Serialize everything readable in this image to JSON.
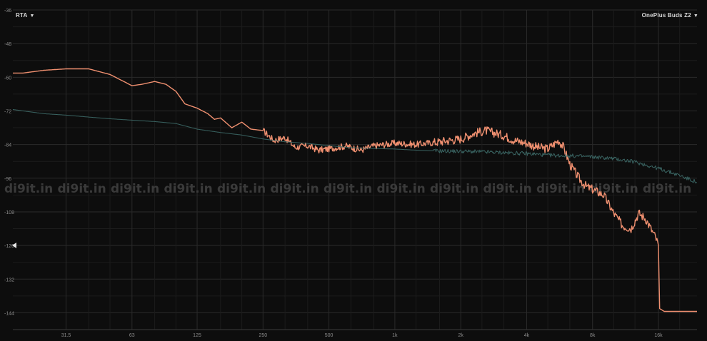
{
  "header": {
    "mode_label": "RTA",
    "device_label": "OnePlus Buds Z2"
  },
  "watermark": {
    "text": "di9it.in",
    "count": 13
  },
  "icons": {
    "mode_caret": "▼",
    "device_caret": "▼",
    "level_marker": "triangle-left"
  },
  "colors": {
    "background": "#0d0d0d",
    "grid": "#2a2a2a",
    "measured": "#f09070",
    "reference": "#3e6d6a",
    "tick_text": "#8c8c8c",
    "watermark": "#3a3a3a"
  },
  "chart_data": {
    "type": "line",
    "title": "",
    "xlabel": "",
    "ylabel": "",
    "xscale": "log",
    "xlim": [
      18,
      24000
    ],
    "ylim": [
      -150,
      -36
    ],
    "grid": true,
    "x_ticks": [
      {
        "value": 31.5,
        "label": "31.5"
      },
      {
        "value": 63,
        "label": "63"
      },
      {
        "value": 125,
        "label": "125"
      },
      {
        "value": 250,
        "label": "250"
      },
      {
        "value": 500,
        "label": "500"
      },
      {
        "value": 1000,
        "label": "1k"
      },
      {
        "value": 2000,
        "label": "2k"
      },
      {
        "value": 4000,
        "label": "4k"
      },
      {
        "value": 8000,
        "label": "8k"
      },
      {
        "value": 16000,
        "label": "16k"
      }
    ],
    "x_minor_ticks": [
      40,
      50,
      80,
      100,
      160,
      200,
      315,
      400,
      630,
      800,
      1250,
      1600,
      2500,
      3150,
      5000,
      6300,
      10000,
      12500,
      20000
    ],
    "y_ticks": [
      -36,
      -48,
      -60,
      -72,
      -84,
      -96,
      -108,
      -120,
      -132,
      -144
    ],
    "y_minor_ticks": [
      -42,
      -54,
      -66,
      -78,
      -90,
      -102,
      -114,
      -126,
      -138
    ],
    "level_marker_value": -120,
    "series": [
      {
        "role": "measured",
        "x": [
          18,
          20,
          25,
          31.5,
          40,
          50,
          63,
          70,
          80,
          90,
          100,
          110,
          125,
          140,
          150,
          160,
          180,
          200,
          220,
          250,
          280,
          315,
          350,
          400,
          450,
          500,
          600,
          700,
          800,
          1000,
          1250,
          1600,
          2000,
          2300,
          2600,
          2900,
          3200,
          3500,
          4000,
          4500,
          5000,
          5300,
          5600,
          5900,
          6300,
          7000,
          7500,
          8000,
          9000,
          10000,
          11000,
          12000,
          13000,
          14000,
          15000,
          15500,
          16000,
          16200,
          17000,
          20000,
          24000
        ],
        "y": [
          -58.5,
          -58.5,
          -57.5,
          -57,
          -57,
          -59,
          -63,
          -62.5,
          -61.5,
          -62.5,
          -65,
          -69.5,
          -71,
          -73,
          -75,
          -74.5,
          -78,
          -76,
          -78.5,
          -79,
          -82.5,
          -81.5,
          -85,
          -84.5,
          -86,
          -85.5,
          -84.5,
          -86,
          -84.5,
          -83.5,
          -84,
          -83,
          -82,
          -80,
          -79,
          -80,
          -81,
          -82.5,
          -83.5,
          -85,
          -85.5,
          -84,
          -82.5,
          -85,
          -91,
          -96.5,
          -99,
          -100,
          -102,
          -108.5,
          -113,
          -114,
          -108.5,
          -110.5,
          -115,
          -117,
          -120,
          -142.5,
          -143.5,
          -143.5,
          -143.5
        ]
      },
      {
        "role": "reference",
        "x": [
          18,
          25,
          31.5,
          40,
          50,
          63,
          80,
          100,
          125,
          160,
          200,
          250,
          315,
          400,
          500,
          630,
          800,
          1000,
          1250,
          1600,
          2000,
          2500,
          3150,
          4000,
          5000,
          6300,
          8000,
          10000,
          12500,
          16000,
          20000,
          24000
        ],
        "y": [
          -71.5,
          -73,
          -73.5,
          -74.2,
          -74.8,
          -75.3,
          -75.8,
          -76.5,
          -78.5,
          -79.7,
          -80.6,
          -82,
          -83,
          -83.6,
          -84.4,
          -85.1,
          -85.4,
          -85.6,
          -86,
          -86.3,
          -86.4,
          -86.6,
          -86.9,
          -87.2,
          -87.8,
          -88,
          -88.4,
          -89,
          -90.2,
          -92.5,
          -95,
          -97.5
        ]
      }
    ]
  }
}
